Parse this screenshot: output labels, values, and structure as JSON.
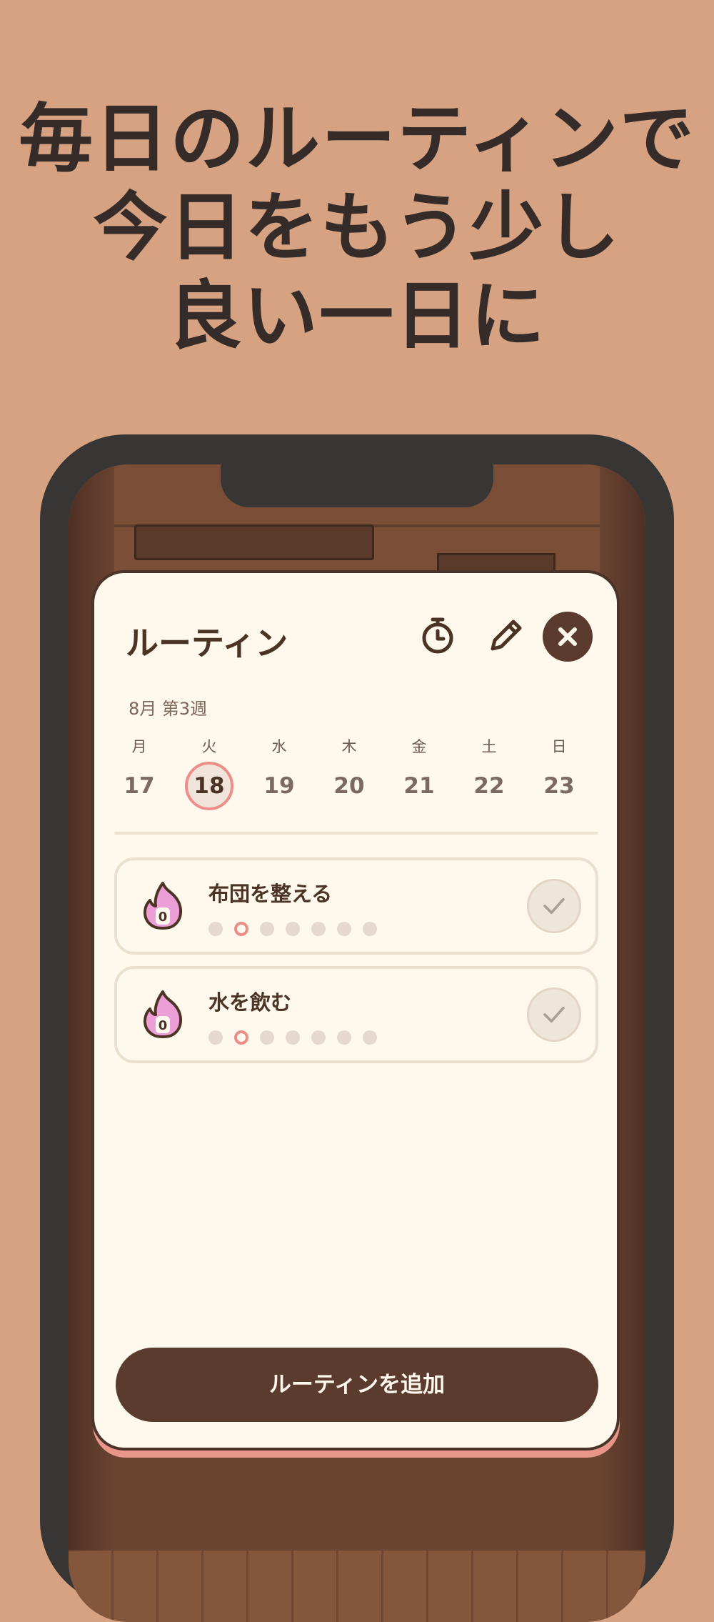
{
  "headline": [
    "毎日のルーティンで",
    "今日をもう少し",
    "良い一日に"
  ],
  "panel": {
    "title": "ルーティン",
    "week_label": "8月 第3週",
    "days": [
      {
        "dow": "月",
        "num": "17",
        "selected": false
      },
      {
        "dow": "火",
        "num": "18",
        "selected": true
      },
      {
        "dow": "水",
        "num": "19",
        "selected": false
      },
      {
        "dow": "木",
        "num": "20",
        "selected": false
      },
      {
        "dow": "金",
        "num": "21",
        "selected": false
      },
      {
        "dow": "土",
        "num": "22",
        "selected": false
      },
      {
        "dow": "日",
        "num": "23",
        "selected": false
      }
    ],
    "routines": [
      {
        "name": "布団を整える",
        "streak": "0",
        "today_index": 1
      },
      {
        "name": "水を飲む",
        "streak": "0",
        "today_index": 1
      }
    ],
    "add_button": "ルーティンを追加",
    "icons": {
      "timer": "timer-icon",
      "edit": "pencil-icon",
      "close": "close-icon",
      "check": "check-icon",
      "streak": "flame-icon"
    }
  },
  "colors": {
    "background": "#d6a282",
    "card": "#fff8ec",
    "primary": "#5a3b2d",
    "accent": "#ec8e8a",
    "flame": "#eb9fd6"
  }
}
